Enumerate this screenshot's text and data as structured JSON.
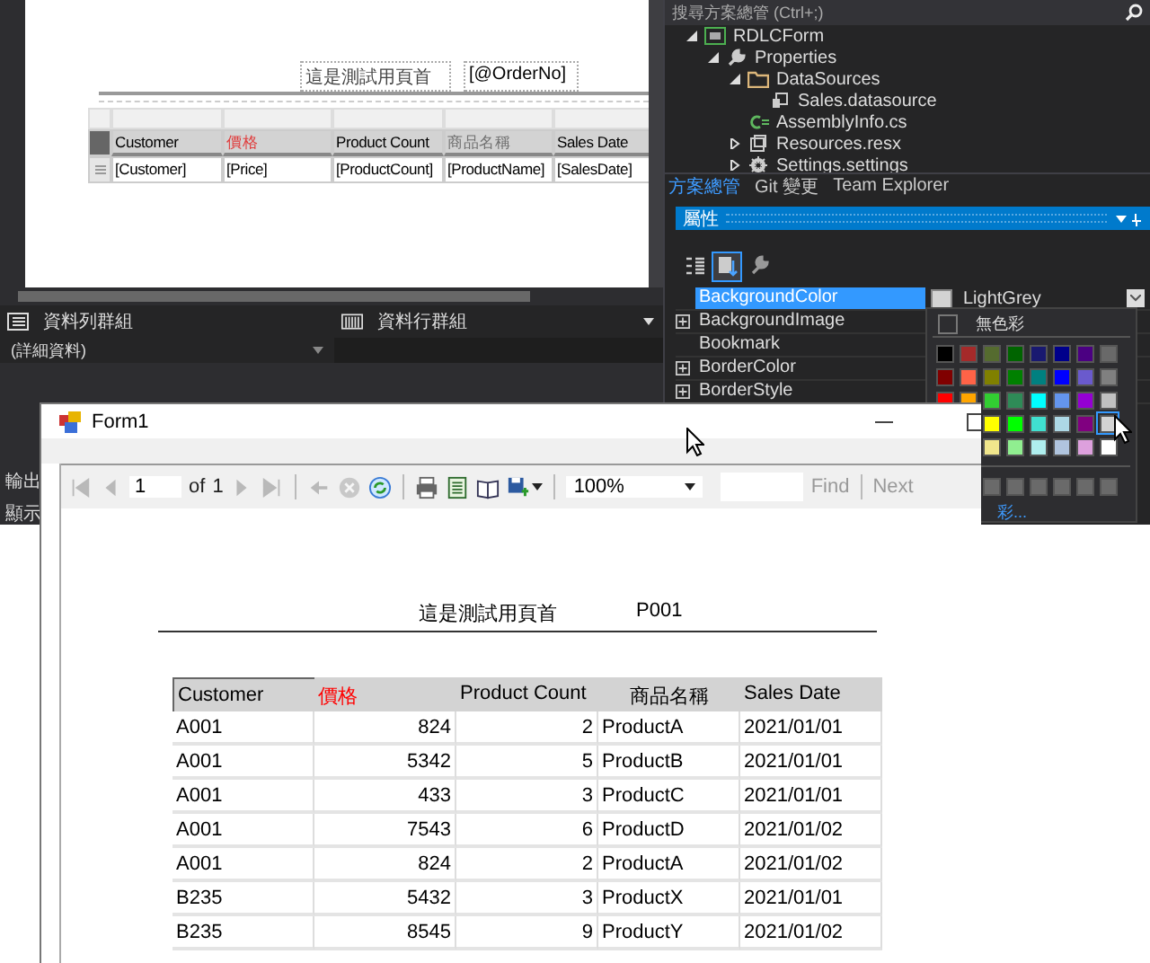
{
  "designer": {
    "header_title": "這是測試用頁首",
    "header_param": "[@OrderNo]",
    "columns": [
      {
        "label": "Customer",
        "color": "#000000",
        "field": "[Customer]"
      },
      {
        "label": "價格",
        "color": "#e03c3c",
        "field": "[Price]"
      },
      {
        "label": "Product Count",
        "color": "#000000",
        "field": "[ProductCount]"
      },
      {
        "label": "商品名稱",
        "color": "#707070",
        "field": "[ProductName]"
      },
      {
        "label": "Sales Date",
        "color": "#000000",
        "field": "[SalesDate]"
      }
    ]
  },
  "row_groups": {
    "title": "資料列群組",
    "items": [
      "(詳細資料)"
    ]
  },
  "column_groups": {
    "title": "資料行群組"
  },
  "output_tabs": [
    "輸出",
    "顯示"
  ],
  "solution_explorer": {
    "search_placeholder": "搜尋方案總管 (Ctrl+;)",
    "tree": [
      {
        "label": "RDLCForm",
        "kind": "project",
        "expanded": true,
        "children": [
          {
            "label": "Properties",
            "kind": "wrench",
            "expanded": true,
            "children": [
              {
                "label": "DataSources",
                "kind": "folder",
                "expanded": true,
                "children": [
                  {
                    "label": "Sales.datasource",
                    "kind": "datasource"
                  }
                ]
              },
              {
                "label": "AssemblyInfo.cs",
                "kind": "csharp"
              },
              {
                "label": "Resources.resx",
                "kind": "resource",
                "expanded": false
              },
              {
                "label": "Settings.settings",
                "kind": "settings",
                "expanded": false
              }
            ]
          }
        ]
      }
    ]
  },
  "panel_tabs": [
    {
      "label": "方案總管",
      "selected": true
    },
    {
      "label": "Git 變更",
      "selected": false
    },
    {
      "label": "Team Explorer",
      "selected": false
    }
  ],
  "properties": {
    "title": "屬性",
    "toolbar": [
      {
        "kind": "categorized",
        "selected": false
      },
      {
        "kind": "alphabetical",
        "selected": true
      },
      {
        "kind": "property-pages",
        "selected": false
      }
    ],
    "rows": [
      {
        "name": "BackgroundColor",
        "expandable": false,
        "selected": true,
        "value": "LightGrey",
        "color": "#d3d3d3"
      },
      {
        "name": "BackgroundImage",
        "expandable": true,
        "selected": false
      },
      {
        "name": "Bookmark",
        "expandable": false,
        "selected": false
      },
      {
        "name": "BorderColor",
        "expandable": true,
        "selected": false
      },
      {
        "name": "BorderStyle",
        "expandable": true,
        "selected": false
      }
    ]
  },
  "color_picker": {
    "no_color": "無色彩",
    "more": "彩...",
    "palette": [
      [
        {
          "color": "#000000",
          "selected": false
        },
        {
          "color": "#a52a2a",
          "selected": false
        },
        {
          "color": "#556b2f",
          "selected": false
        },
        {
          "color": "#006400",
          "selected": false
        },
        {
          "color": "#191970",
          "selected": false
        },
        {
          "color": "#00008b",
          "selected": false
        },
        {
          "color": "#4b0082",
          "selected": false
        },
        {
          "color": "#696969",
          "selected": false
        }
      ],
      [
        {
          "color": "#800000",
          "selected": false
        },
        {
          "color": "#ff6347",
          "selected": false
        },
        {
          "color": "#808000",
          "selected": false
        },
        {
          "color": "#008000",
          "selected": false
        },
        {
          "color": "#008080",
          "selected": false
        },
        {
          "color": "#0000ff",
          "selected": false
        },
        {
          "color": "#6a5acd",
          "selected": false
        },
        {
          "color": "#808080",
          "selected": false
        }
      ],
      [
        {
          "color": "#ff0000",
          "selected": false
        },
        {
          "color": "#ffa500",
          "selected": false
        },
        {
          "color": "#32cd32",
          "selected": false
        },
        {
          "color": "#2e8b57",
          "selected": false
        },
        {
          "color": "#00ffff",
          "selected": false
        },
        {
          "color": "#6495ed",
          "selected": false
        },
        {
          "color": "#9400d3",
          "selected": false
        },
        {
          "color": "#c0c0c0",
          "selected": false
        }
      ],
      [
        {
          "color": "#ffff00",
          "selected": false
        },
        {
          "color": "#00ff00",
          "selected": false
        },
        {
          "color": "#40e0d0",
          "selected": false
        },
        {
          "color": "#add8e6",
          "selected": false
        },
        {
          "color": "#800080",
          "selected": false
        },
        {
          "color": "#d3d3d3",
          "selected": true
        }
      ],
      [
        {
          "color": "#f0e68c",
          "selected": false
        },
        {
          "color": "#90ee90",
          "selected": false
        },
        {
          "color": "#afeeee",
          "selected": false
        },
        {
          "color": "#b0c4de",
          "selected": false
        },
        {
          "color": "#dda0dd",
          "selected": false
        },
        {
          "color": "#ffffff",
          "selected": false
        }
      ]
    ]
  },
  "form_window": {
    "title": "Form1",
    "toolbar": [
      {
        "kind": "first",
        "disabled": true
      },
      {
        "kind": "prev",
        "disabled": true
      },
      {
        "kind": "page",
        "value": "1"
      },
      {
        "kind": "text",
        "label": "of"
      },
      {
        "kind": "text",
        "label": "1"
      },
      {
        "kind": "next",
        "disabled": true
      },
      {
        "kind": "last",
        "disabled": true
      },
      {
        "kind": "sep"
      },
      {
        "kind": "back",
        "disabled": true
      },
      {
        "kind": "stop",
        "disabled": true
      },
      {
        "kind": "refresh",
        "disabled": false
      },
      {
        "kind": "sep"
      },
      {
        "kind": "print",
        "disabled": false
      },
      {
        "kind": "layout",
        "disabled": false
      },
      {
        "kind": "setup",
        "disabled": false
      },
      {
        "kind": "export",
        "disabled": false
      },
      {
        "kind": "sep"
      },
      {
        "kind": "zoom",
        "value": "100%"
      },
      {
        "kind": "find-field"
      },
      {
        "kind": "link",
        "label": "Find",
        "disabled": true
      },
      {
        "kind": "sep"
      },
      {
        "kind": "link",
        "label": "Next",
        "disabled": true
      }
    ],
    "report": {
      "header_title": "這是測試用頁首",
      "order_no": "P001",
      "columns": [
        {
          "label": "Customer",
          "color": "#000000"
        },
        {
          "label": "價格",
          "color": "#ff0000"
        },
        {
          "label": "Product Count",
          "color": "#000000"
        },
        {
          "label": "商品名稱",
          "color": "#000000"
        },
        {
          "label": "Sales Date",
          "color": "#000000"
        }
      ],
      "rows": [
        [
          "A001",
          "824",
          "2",
          "ProductA",
          "2021/01/01"
        ],
        [
          "A001",
          "5342",
          "5",
          "ProductB",
          "2021/01/01"
        ],
        [
          "A001",
          "433",
          "3",
          "ProductC",
          "2021/01/01"
        ],
        [
          "A001",
          "7543",
          "6",
          "ProductD",
          "2021/01/02"
        ],
        [
          "A001",
          "824",
          "2",
          "ProductA",
          "2021/01/02"
        ],
        [
          "B235",
          "5432",
          "3",
          "ProductX",
          "2021/01/01"
        ],
        [
          "B235",
          "8545",
          "9",
          "ProductY",
          "2021/01/02"
        ]
      ]
    }
  }
}
